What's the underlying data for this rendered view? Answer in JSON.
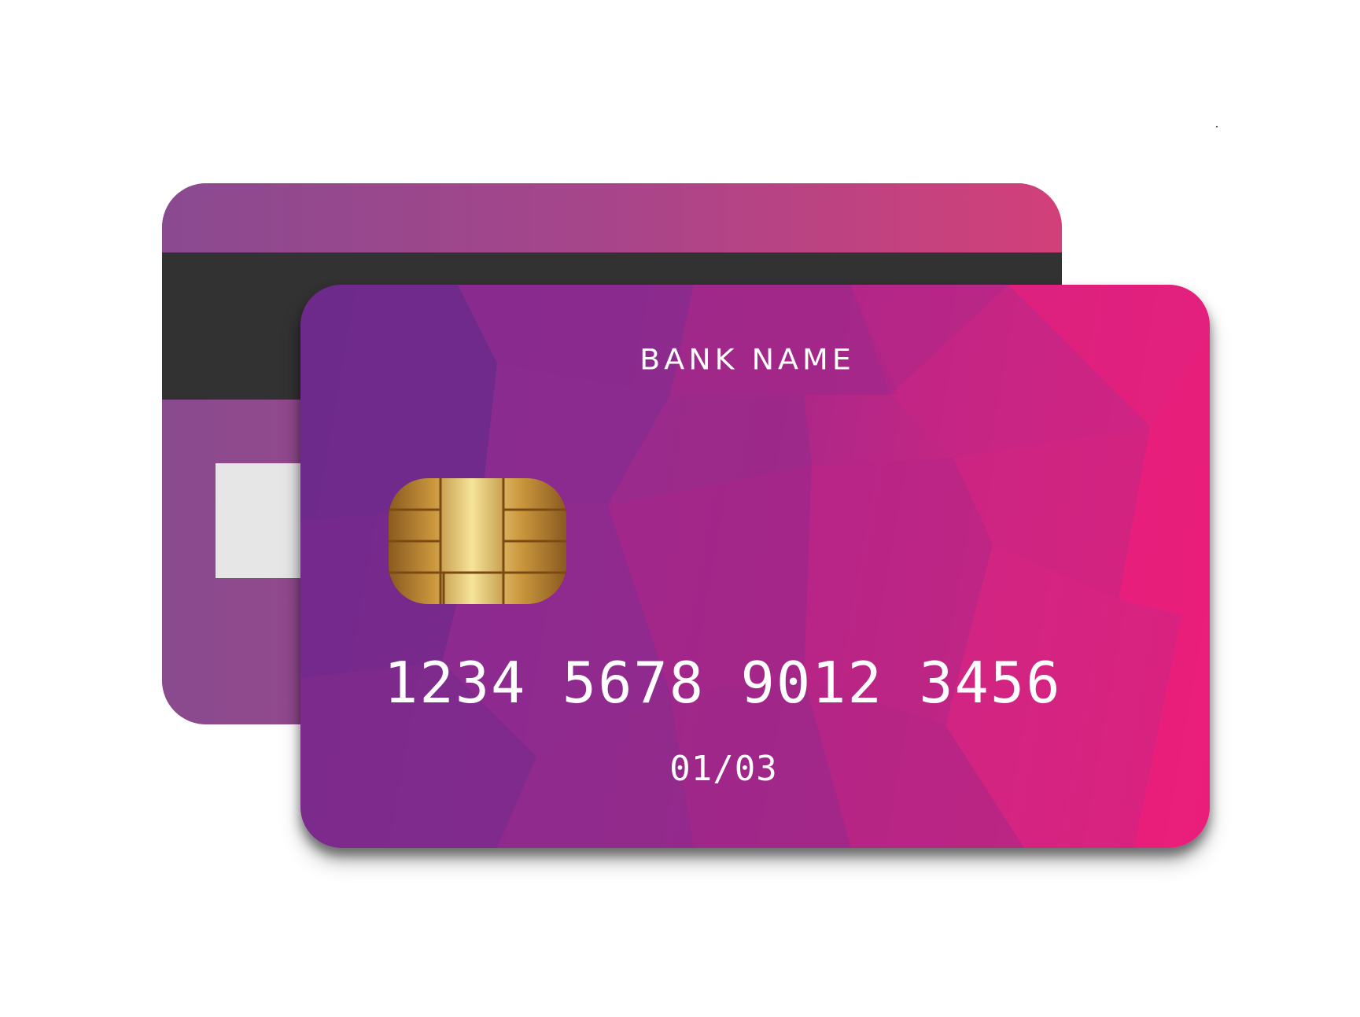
{
  "front_card": {
    "bank_name": "BANK NAME",
    "card_number": "1234 5678 9012 3456",
    "expiry": "01/03",
    "colors": {
      "left": "#712b8c",
      "middle": "#aa2788",
      "right": "#ee1f7a",
      "text": "#ffffff"
    },
    "chip": {
      "icon": "emv-chip-icon",
      "color": "#c9a04a"
    }
  },
  "back_card": {
    "magnetic_stripe_color": "#323232",
    "signature_panel_color": "#e6e6e6",
    "colors": {
      "left": "#88498f",
      "right": "#d3407a"
    }
  }
}
